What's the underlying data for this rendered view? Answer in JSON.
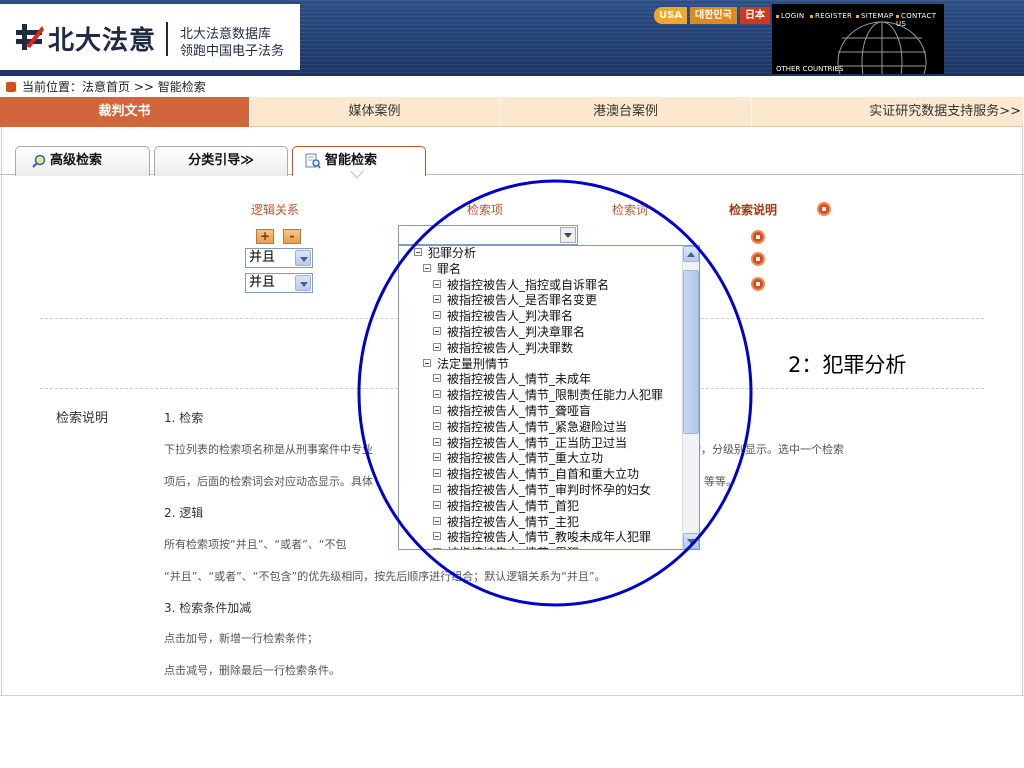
{
  "header": {
    "logo_text": "北大法意",
    "slogan_line1": "北大法意数据库",
    "slogan_line2": "领跑中国电子法务",
    "languages": [
      "USA",
      "대한민국",
      "日本"
    ],
    "top_links": [
      "LOGIN",
      "REGISTER",
      "SITEMAP",
      "CONTACT US"
    ],
    "other_countries": "OTHER COUNTRIES"
  },
  "breadcrumb": {
    "text": "当前位置：法意首页 >> 智能检索"
  },
  "main_tabs": [
    {
      "label": "裁判文书"
    },
    {
      "label": "媒体案例"
    },
    {
      "label": "港澳台案例"
    },
    {
      "label": "实证研究数据支持服务>>"
    }
  ],
  "sub_tabs": [
    {
      "label": "高级检索"
    },
    {
      "label": "分类引导≫"
    },
    {
      "label": "智能检索"
    }
  ],
  "form": {
    "col_logic": "逻辑关系",
    "col_item": "检索项",
    "col_term": "检索词",
    "col_explain": "检索说明",
    "plus_label": "+",
    "minus_label": "-",
    "logic_rows": [
      "并且",
      "并且"
    ]
  },
  "tree": {
    "items": [
      {
        "label": "犯罪分析",
        "level": 0
      },
      {
        "label": "罪名",
        "level": 1
      },
      {
        "label": "被指控被告人_指控或自诉罪名",
        "level": 2
      },
      {
        "label": "被指控被告人_是否罪名变更",
        "level": 2
      },
      {
        "label": "被指控被告人_判决罪名",
        "level": 2
      },
      {
        "label": "被指控被告人_判决章罪名",
        "level": 2
      },
      {
        "label": "被指控被告人_判决罪数",
        "level": 2
      },
      {
        "label": "法定量刑情节",
        "level": 1
      },
      {
        "label": "被指控被告人_情节_未成年",
        "level": 2
      },
      {
        "label": "被指控被告人_情节_限制责任能力人犯罪",
        "level": 2
      },
      {
        "label": "被指控被告人_情节_聋哑盲",
        "level": 2
      },
      {
        "label": "被指控被告人_情节_紧急避险过当",
        "level": 2
      },
      {
        "label": "被指控被告人_情节_正当防卫过当",
        "level": 2
      },
      {
        "label": "被指控被告人_情节_重大立功",
        "level": 2
      },
      {
        "label": "被指控被告人_情节_自首和重大立功",
        "level": 2
      },
      {
        "label": "被指控被告人_情节_审判时怀孕的妇女",
        "level": 2
      },
      {
        "label": "被指控被告人_情节_首犯",
        "level": 2
      },
      {
        "label": "被指控被告人_情节_主犯",
        "level": 2
      },
      {
        "label": "被指控被告人_情节_教唆未成年人犯罪",
        "level": 2
      },
      {
        "label": "被指控被告人_情节_累犯",
        "level": 2
      }
    ]
  },
  "explanation": {
    "title": "检索说明",
    "h1": "1. 检索",
    "p1_left": "下拉列表的检索项名称是从刑事案件中专业",
    "p1_right": "构，分级别显示。选中一个检索",
    "p2_left": "项后，后面的检索词会对应动态显示。具体",
    "p2_right": "等等。",
    "h2": "2. 逻辑",
    "p3_left": "所有检索项按“并且”、“或者”、“不包",
    "p4": "“并且”、“或者”、“不包含”的优先级相同，按先后顺序进行组合；默认逻辑关系为“并且”。",
    "h3": "3. 检索条件加减",
    "p5": "点击加号，新增一行检索条件；",
    "p6": "点击减号，删除最后一行检索条件。"
  },
  "annotation": {
    "text": "2：犯罪分析"
  },
  "colors": {
    "header_bg": "#1b3563",
    "active_tab": "#d0663a",
    "tab_bar": "#fbe8cf",
    "accent_text": "#c0552b",
    "circle": "#0000cc"
  }
}
